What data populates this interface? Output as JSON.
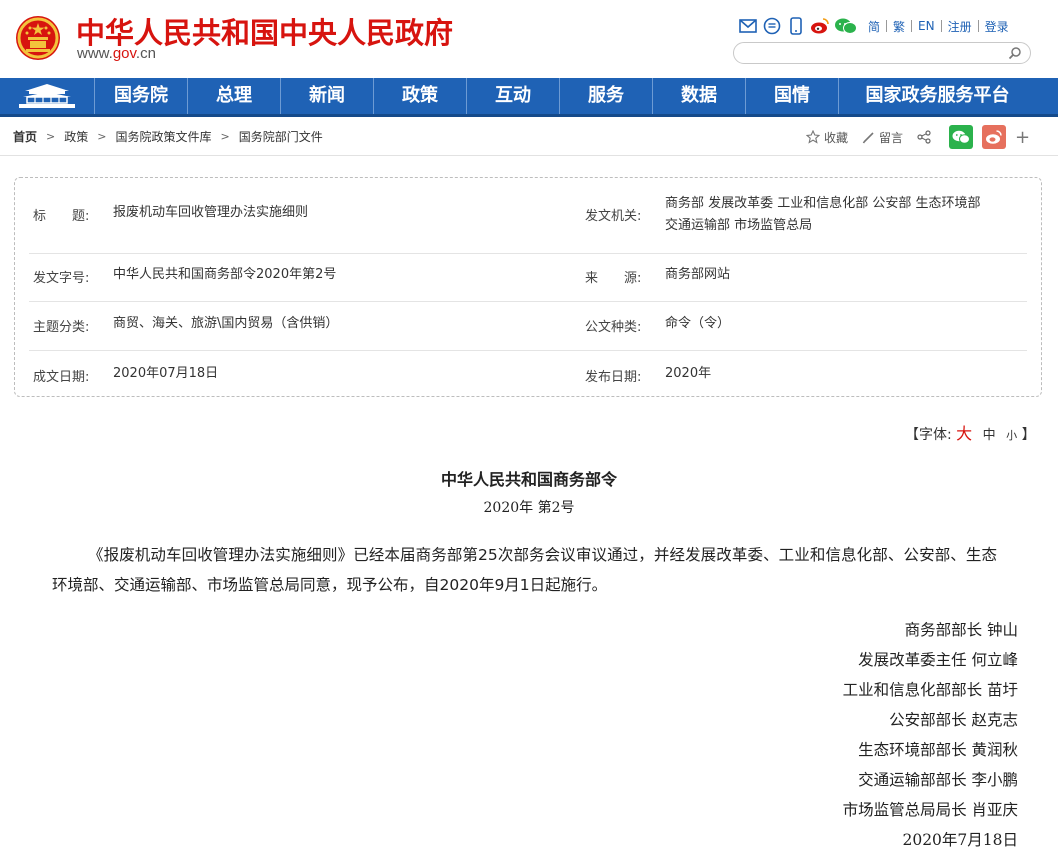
{
  "header": {
    "site_title": "中华人民共和国中央人民政府",
    "domain_prefix": "www.",
    "domain_accent": "gov",
    "domain_suffix": ".cn",
    "links": [
      "简",
      "繁",
      "EN",
      "注册",
      "登录"
    ],
    "search_placeholder": ""
  },
  "nav": {
    "items": [
      "国务院",
      "总理",
      "新闻",
      "政策",
      "互动",
      "服务",
      "数据",
      "国情",
      "国家政务服务平台"
    ]
  },
  "breadcrumb": {
    "items": [
      "首页",
      "政策",
      "国务院政策文件库",
      "国务院部门文件"
    ]
  },
  "tools": {
    "favorite": "收藏",
    "comment": "留言",
    "more": "+"
  },
  "info": {
    "title_label": "标　　题:",
    "title_value": "报废机动车回收管理办法实施细则",
    "issuer_label": "发文机关:",
    "issuer_line1": "商务部 发展改革委 工业和信息化部 公安部 生态环境部",
    "issuer_line2": "交通运输部 市场监管总局",
    "docno_label": "发文字号:",
    "docno_value": "中华人民共和国商务部令2020年第2号",
    "source_label": "来　　源:",
    "source_value": "商务部网站",
    "category_label": "主题分类:",
    "category_value": "商贸、海关、旅游\\国内贸易（含供销）",
    "doctype_label": "公文种类:",
    "doctype_value": "命令（令）",
    "written_label": "成文日期:",
    "written_value": "2020年07月18日",
    "published_label": "发布日期:",
    "published_value": "2020年"
  },
  "fontsize": {
    "prefix": "【字体:",
    "large": "大",
    "medium": "中",
    "small": "小",
    "suffix": "】"
  },
  "article": {
    "title": "中华人民共和国商务部令",
    "subtitle": "2020年 第2号",
    "paragraph": "《报废机动车回收管理办法实施细则》已经本届商务部第25次部务会议审议通过，并经发展改革委、工业和信息化部、公安部、生态环境部、交通运输部、市场监管总局同意，现予公布，自2020年9月1日起施行。",
    "signatures": [
      "商务部部长  钟山",
      "发展改革委主任  何立峰",
      "工业和信息化部部长  苗圩",
      "公安部部长  赵克志",
      "生态环境部部长  黄润秋",
      "交通运输部部长  李小鹏",
      "市场监管总局局长  肖亚庆",
      "2020年7月18日"
    ]
  },
  "colors": {
    "brand_red": "#d7140f",
    "nav_blue": "#1f62b5",
    "wechat_green": "#2bb24c",
    "weibo_red": "#e6705d"
  }
}
